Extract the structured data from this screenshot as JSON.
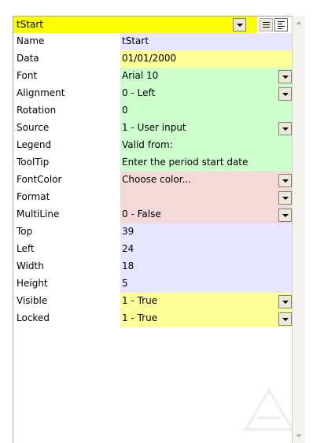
{
  "header": {
    "control_name": "tStart",
    "color": "#ffff00"
  },
  "toolbar": {
    "dropdown_icon": "chevron-down-icon",
    "list_view_icon": "list-view-icon",
    "detail_view_icon": "detail-view-icon"
  },
  "properties": [
    {
      "label": "Name",
      "value": "tStart",
      "bg": "#e6e6ff",
      "dropdown": false
    },
    {
      "label": "Data",
      "value": "01/01/2000",
      "bg": "#ffff99",
      "dropdown": false
    },
    {
      "label": "Font",
      "value": "Arial 10",
      "bg": "#ccffcc",
      "dropdown": true
    },
    {
      "label": "Alignment",
      "value": "0 - Left",
      "bg": "#ccffcc",
      "dropdown": true
    },
    {
      "label": "Rotation",
      "value": "0",
      "bg": "#ccffcc",
      "dropdown": false
    },
    {
      "label": "Source",
      "value": "1 - User input",
      "bg": "#ccffcc",
      "dropdown": true
    },
    {
      "label": "Legend",
      "value": "Valid from:",
      "bg": "#ccffcc",
      "dropdown": false
    },
    {
      "label": "ToolTip",
      "value": "Enter the period start date",
      "bg": "#ccffcc",
      "dropdown": false
    },
    {
      "label": "FontColor",
      "value": "Choose color...",
      "bg": "#f5d9d9",
      "dropdown": true
    },
    {
      "label": "Format",
      "value": "",
      "bg": "#f5d9d9",
      "dropdown": true
    },
    {
      "label": "MultiLine",
      "value": "0 - False",
      "bg": "#f5d9d9",
      "dropdown": true
    },
    {
      "label": "Top",
      "value": "39",
      "bg": "#e6e6ff",
      "dropdown": false
    },
    {
      "label": "Left",
      "value": "24",
      "bg": "#e6e6ff",
      "dropdown": false
    },
    {
      "label": "Width",
      "value": "18",
      "bg": "#e6e6ff",
      "dropdown": false
    },
    {
      "label": "Height",
      "value": "5",
      "bg": "#e6e6ff",
      "dropdown": false
    },
    {
      "label": "Visible",
      "value": "1 - True",
      "bg": "#ffff99",
      "dropdown": true
    },
    {
      "label": "Locked",
      "value": "1 - True",
      "bg": "#ffff99",
      "dropdown": true
    }
  ]
}
